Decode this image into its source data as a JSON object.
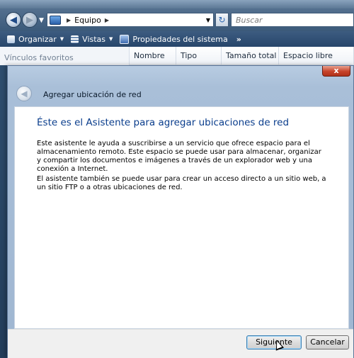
{
  "explorer": {
    "address": {
      "segments": [
        "Equipo"
      ]
    },
    "search_placeholder": "Buscar",
    "toolbar": {
      "organize": "Organizar",
      "views": "Vistas",
      "system_properties": "Propiedades del sistema",
      "more": "»"
    },
    "left_pane_header": "Vínculos favoritos",
    "columns": [
      "Nombre",
      "Tipo",
      "Tamaño total",
      "Espacio libre"
    ]
  },
  "wizard": {
    "window_title": "Agregar ubicación de red",
    "close_label": "x",
    "heading": "Éste es el Asistente para agregar ubicaciones de red",
    "paragraph1": "Este asistente le ayuda a suscribirse a un servicio que ofrece espacio para el almacenamiento remoto. Este espacio se puede usar para almacenar, organizar y compartir los documentos e imágenes a través de un explorador web y una conexión a Internet.",
    "paragraph2": "El asistente también se puede usar para crear un acceso directo a un sitio web, a un sitio FTP o a otras ubicaciones de red.",
    "buttons": {
      "next": "Siguiente",
      "cancel": "Cancelar"
    }
  },
  "colors": {
    "heading": "#0a3d8c",
    "chrome": "#a9bfd8",
    "close": "#c7432a"
  },
  "icons": [
    "back-arrow-icon",
    "forward-arrow-icon",
    "computer-icon",
    "refresh-icon",
    "organize-icon",
    "views-icon",
    "system-properties-icon",
    "close-icon",
    "mouse-cursor-icon"
  ]
}
